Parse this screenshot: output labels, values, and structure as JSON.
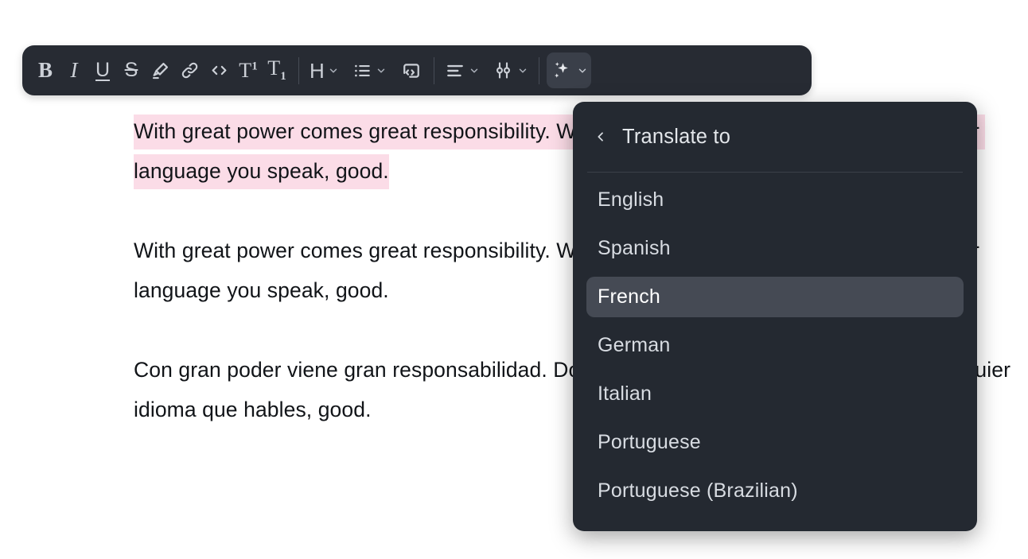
{
  "colors": {
    "toolbar_bg": "#272b33",
    "menu_bg": "#242931",
    "menu_selected_bg": "#454a54",
    "highlight_pink": "#fbdce7",
    "text_dark": "#111418",
    "icon_grey": "#ccd0d7",
    "page_bg": "#ffffff"
  },
  "document": {
    "paragraphs": [
      {
        "id": "paragraph-english-highlighted",
        "highlighted": true,
        "text": "With great power comes great responsibility. Wherever you are in the world, and whatever language you speak, good."
      },
      {
        "id": "paragraph-english",
        "highlighted": false,
        "text": "With great power comes great responsibility. Wherever you are in the world, and whatever language you speak, good."
      },
      {
        "id": "paragraph-spanish",
        "highlighted": false,
        "text": "Con gran poder viene gran responsabilidad. Dondequiera que estés en el mundo, y cualquier idioma que hables, good."
      }
    ]
  },
  "toolbar": {
    "items": [
      {
        "name": "bold-button",
        "icon": "bold-icon",
        "label": "B",
        "type": "glyph-b",
        "dropdown": false,
        "active": false
      },
      {
        "name": "italic-button",
        "icon": "italic-icon",
        "label": "I",
        "type": "glyph-i",
        "dropdown": false,
        "active": false
      },
      {
        "name": "underline-button",
        "icon": "underline-icon",
        "label": "U",
        "type": "glyph-u",
        "dropdown": false,
        "active": false
      },
      {
        "name": "strikethrough-button",
        "icon": "strikethrough-icon",
        "label": "S",
        "type": "glyph-s",
        "dropdown": false,
        "active": false
      },
      {
        "name": "highlight-button",
        "icon": "highlighter-pen-icon",
        "label": "",
        "type": "svg",
        "dropdown": false,
        "active": false
      },
      {
        "name": "link-button",
        "icon": "link-icon",
        "label": "",
        "type": "svg",
        "dropdown": false,
        "active": false
      },
      {
        "name": "inline-code-button",
        "icon": "code-brackets-icon",
        "label": "",
        "type": "svg",
        "dropdown": false,
        "active": false
      },
      {
        "name": "superscript-button",
        "icon": "superscript-icon",
        "label": "T",
        "type": "glyph-sup",
        "dropdown": false,
        "active": false
      },
      {
        "name": "subscript-button",
        "icon": "subscript-icon",
        "label": "T",
        "type": "glyph-sup",
        "dropdown": false,
        "active": false
      },
      {
        "name": "heading-button",
        "icon": "heading-icon",
        "label": "H",
        "type": "glyph-h",
        "dropdown": true,
        "active": false
      },
      {
        "name": "bullet-list-button",
        "icon": "bullet-list-icon",
        "label": "",
        "type": "svg",
        "dropdown": true,
        "active": false
      },
      {
        "name": "code-block-button",
        "icon": "code-block-icon",
        "label": "",
        "type": "svg",
        "dropdown": false,
        "active": false
      },
      {
        "name": "text-align-button",
        "icon": "align-left-icon",
        "label": "",
        "type": "svg",
        "dropdown": true,
        "active": false
      },
      {
        "name": "more-options-button",
        "icon": "sliders-icon",
        "label": "",
        "type": "svg",
        "dropdown": true,
        "active": false
      },
      {
        "name": "ai-assistant-button",
        "icon": "sparkles-icon",
        "label": "",
        "type": "svg",
        "dropdown": true,
        "active": true
      }
    ]
  },
  "translate_menu": {
    "back_icon": "chevron-left-icon",
    "title": "Translate to",
    "languages": [
      {
        "label": "English",
        "selected": false
      },
      {
        "label": "Spanish",
        "selected": false
      },
      {
        "label": "French",
        "selected": true
      },
      {
        "label": "German",
        "selected": false
      },
      {
        "label": "Italian",
        "selected": false
      },
      {
        "label": "Portuguese",
        "selected": false
      },
      {
        "label": "Portuguese (Brazilian)",
        "selected": false
      }
    ]
  }
}
